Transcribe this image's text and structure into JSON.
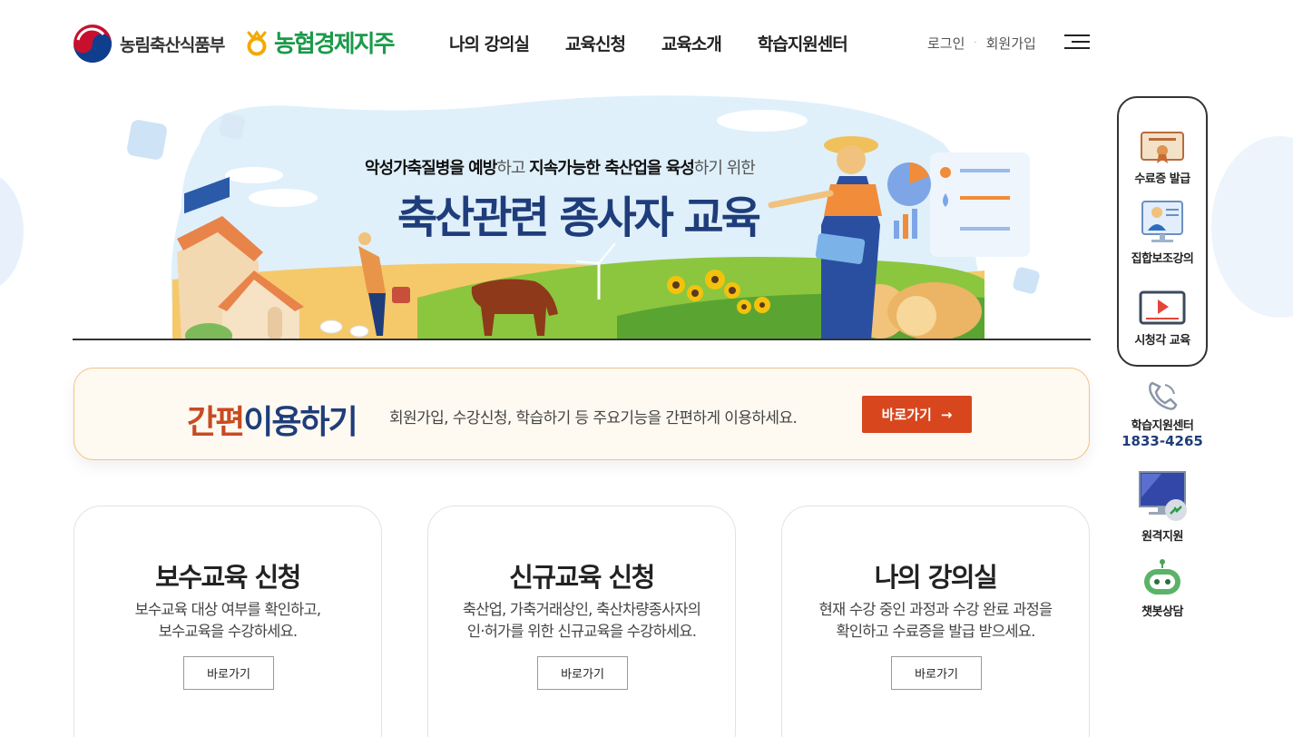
{
  "header": {
    "gov_logo_text": "농림축산식품부",
    "nh_logo_text": "농협경제지주",
    "gnb": [
      {
        "label": "나의 강의실"
      },
      {
        "label": "교육신청"
      },
      {
        "label": "교육소개"
      },
      {
        "label": "학습지원센터"
      }
    ],
    "login": "로그인",
    "separator": "·",
    "signup": "회원가입"
  },
  "hero": {
    "sub_part1": "악성가축질병을 예방",
    "sub_part2": "하고",
    "sub_part3": "지속가능한 축산업을 육성",
    "sub_part4": "하기 위한",
    "title": "축산관련 종사자 교육"
  },
  "quick": {
    "title_a": "간편",
    "title_b": "이용하기",
    "desc": "회원가입, 수강신청, 학습하기 등 주요기능을 간편하게 이용하세요.",
    "button": "바로가기",
    "arrow": "→"
  },
  "cards": [
    {
      "title": "보수교육 신청",
      "desc1": "보수교육 대상 여부를 확인하고,",
      "desc2": "보수교육을 수강하세요.",
      "button": "바로가기"
    },
    {
      "title": "신규교육 신청",
      "desc1": "축산업, 가축거래상인, 축산차량종사자의",
      "desc2": "인·허가를 위한 신규교육을 수강하세요.",
      "button": "바로가기"
    },
    {
      "title": "나의 강의실",
      "desc1": "현재 수강 중인 과정과 수강 완료 과정을",
      "desc2": "확인하고 수료증을 발급 받으세요.",
      "button": "바로가기"
    }
  ],
  "side_menu": {
    "certificate": "수료증 발급",
    "group": "집합보조강의",
    "video": "시청각 교육",
    "support_label": "학습지원센터",
    "support_phone": "1833-4265",
    "remote": "원격지원",
    "chatbot": "챗봇상담"
  },
  "icons": {
    "certificate": "certificate-icon",
    "group": "lecture-icon",
    "video": "video-play-icon",
    "phone": "phone-icon",
    "remote": "monitor-icon",
    "chatbot": "robot-icon",
    "menu": "hamburger-icon"
  },
  "colors": {
    "brand_navy": "#1f3d7a",
    "accent_orange": "#d8461e",
    "nh_green": "#1b9a4a",
    "quick_bg": "#fffaf1"
  }
}
